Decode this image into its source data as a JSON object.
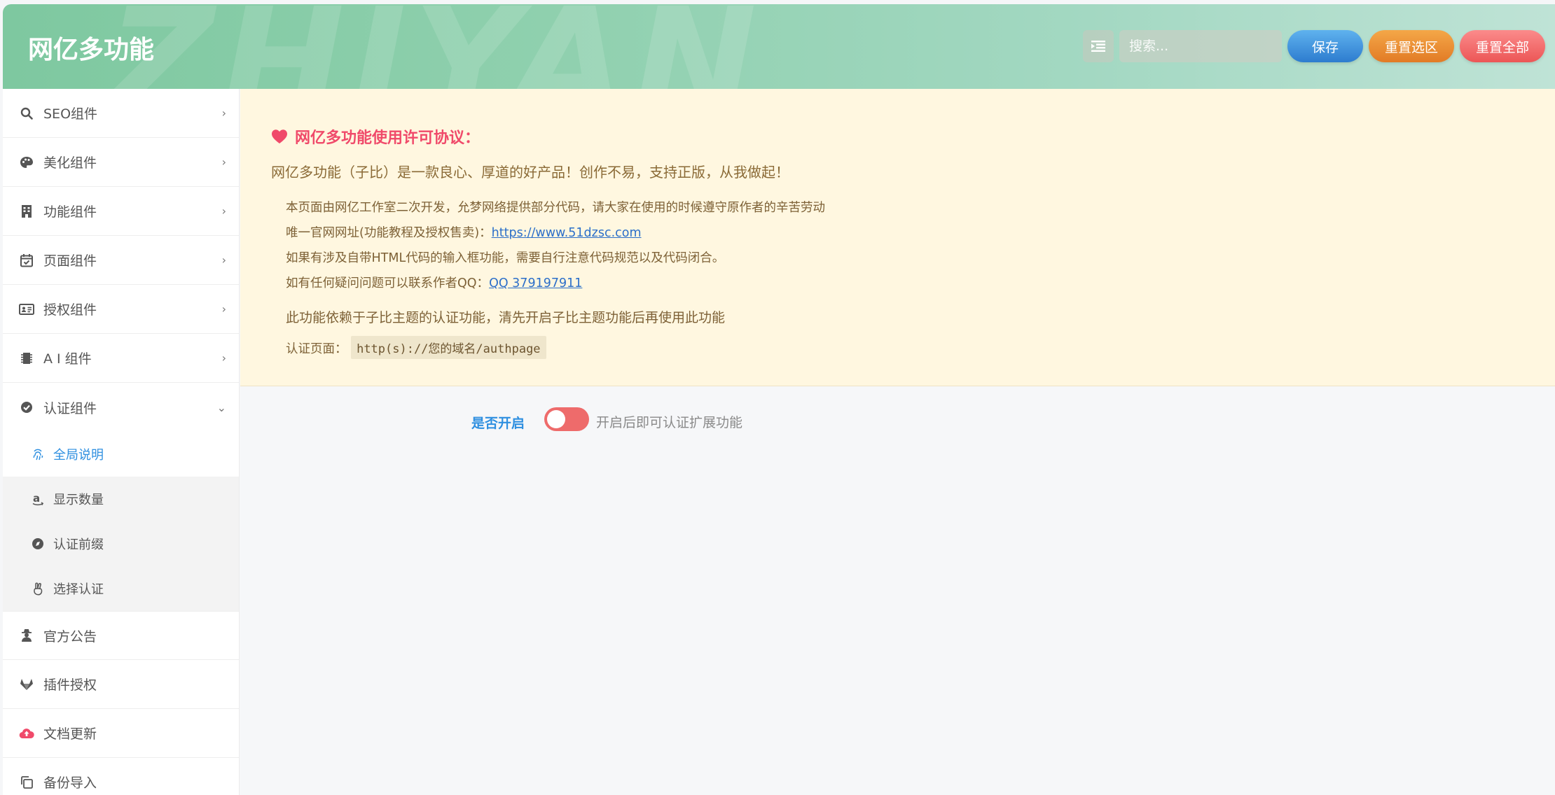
{
  "header": {
    "title": "网亿多功能",
    "watermark": "ZHIYAN",
    "search_placeholder": "搜索...",
    "save_label": "保存",
    "reset_section_label": "重置选区",
    "reset_all_label": "重置全部"
  },
  "sidebar": {
    "items": [
      {
        "label": "SEO组件",
        "icon": "search-icon"
      },
      {
        "label": "美化组件",
        "icon": "palette-icon"
      },
      {
        "label": "功能组件",
        "icon": "building-icon"
      },
      {
        "label": "页面组件",
        "icon": "calendar-check-icon"
      },
      {
        "label": "授权组件",
        "icon": "id-card-icon"
      },
      {
        "label": "A I 组件",
        "icon": "chip-icon"
      },
      {
        "label": "认证组件",
        "icon": "check-circle-icon"
      }
    ],
    "subitems": [
      {
        "label": "全局说明",
        "icon": "fingerprint-icon",
        "active": true
      },
      {
        "label": "显示数量",
        "icon": "amazon-icon"
      },
      {
        "label": "认证前缀",
        "icon": "compass-icon"
      },
      {
        "label": "选择认证",
        "icon": "hand-peace-icon"
      }
    ],
    "bottom_items": [
      {
        "label": "官方公告",
        "icon": "user-secret-icon"
      },
      {
        "label": "插件授权",
        "icon": "gitlab-icon"
      },
      {
        "label": "文档更新",
        "icon": "cloud-upload-icon"
      },
      {
        "label": "备份导入",
        "icon": "copy-icon"
      }
    ]
  },
  "notice": {
    "heading": "网亿多功能使用许可协议：",
    "lead": "网亿多功能（子比）是一款良心、厚道的好产品！创作不易，支持正版，从我做起！",
    "line1": "本页面由网亿工作室二次开发，允梦网络提供部分代码，请大家在使用的时候遵守原作者的辛苦劳动",
    "line2_prefix": "唯一官网网址(功能教程及授权售卖)：",
    "line2_link": "https://www.51dzsc.com",
    "line3": "如果有涉及自带HTML代码的输入框功能，需要自行注意代码规范以及代码闭合。",
    "line4_prefix": "如有任何疑问问题可以联系作者QQ：",
    "line4_link": "QQ 379197911",
    "line5": "此功能依赖于子比主题的认证功能，清先开启子比主题功能后再使用此功能",
    "line6_prefix": "认证页面：",
    "line6_code": "http(s)://您的域名/authpage"
  },
  "setting": {
    "label": "是否开启",
    "switch_on": false,
    "description": "开启后即可认证扩展功能"
  },
  "colors": {
    "accent_blue": "#2e8fe0",
    "heading_pink": "#f04a6a",
    "switch_off": "#ee6b6b"
  }
}
